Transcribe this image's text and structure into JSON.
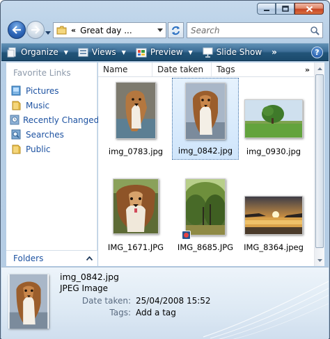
{
  "window": {
    "caption_buttons": [
      "minimize-icon",
      "maximize-icon",
      "close-icon"
    ]
  },
  "nav": {
    "breadcrumb_chevron": "«",
    "address_path": "Great day ...",
    "search_placeholder": "Search"
  },
  "toolbar": {
    "organize_label": "Organize",
    "views_label": "Views",
    "preview_label": "Preview",
    "slideshow_label": "Slide Show",
    "more_label": "»",
    "help_label": "?"
  },
  "sidebar": {
    "heading": "Favorite Links",
    "items": [
      {
        "label": "Pictures",
        "icon": "pictures-icon"
      },
      {
        "label": "Music",
        "icon": "music-folder-icon"
      },
      {
        "label": "Recently Changed",
        "icon": "recently-changed-icon"
      },
      {
        "label": "Searches",
        "icon": "searches-icon"
      },
      {
        "label": "Public",
        "icon": "public-folder-icon"
      }
    ],
    "folders_label": "Folders",
    "folders_caret": "^"
  },
  "columns": {
    "headers": [
      "Name",
      "Date taken",
      "Tags"
    ],
    "more": "»"
  },
  "files": [
    {
      "name": "img_0783.jpg",
      "selected": false
    },
    {
      "name": "img_0842.jpg",
      "selected": true
    },
    {
      "name": "img_0930.jpg",
      "selected": false
    },
    {
      "name": "IMG_1671.JPG",
      "selected": false
    },
    {
      "name": "IMG_8685.JPG",
      "selected": false
    },
    {
      "name": "IMG_8364.jpeg",
      "selected": false
    }
  ],
  "details": {
    "name": "img_0842.jpg",
    "type": "JPEG Image",
    "date_label": "Date taken:",
    "date_value": "25/04/2008 15:52",
    "tags_label": "Tags:",
    "tags_value": "Add a tag"
  },
  "colors": {
    "command_bar": "#2a5b82",
    "link_blue": "#1d52a1",
    "selection": "#cfe5fb"
  }
}
